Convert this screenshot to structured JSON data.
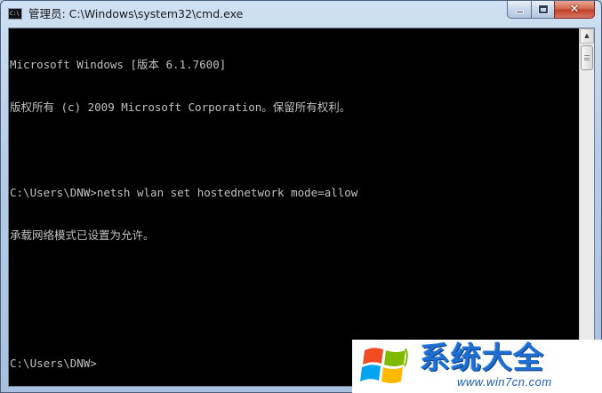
{
  "window": {
    "title": "管理员: C:\\Windows\\system32\\cmd.exe",
    "icon": "cmd-console-icon",
    "icon_text": "C:\\",
    "controls": {
      "minimize": "minimize-icon",
      "maximize": "maximize-icon",
      "close": "close-icon",
      "close_glyph": "✕"
    }
  },
  "console": {
    "lines": [
      "Microsoft Windows [版本 6.1.7600]",
      "版权所有 (c) 2009 Microsoft Corporation。保留所有权利。",
      "",
      "C:\\Users\\DNW>netsh wlan set hostednetwork mode=allow",
      "承载网络模式已设置为允许。",
      "",
      "",
      "C:\\Users\\DNW>"
    ],
    "text_color": "#c0c0c0",
    "background": "#000000"
  },
  "scrollbar": {
    "up_arrow": "▲"
  },
  "watermark": {
    "title": "系统大全",
    "url": "www.win7cn.com",
    "logo": "windows-flag-logo",
    "colors": {
      "red": "#f04b23",
      "green": "#7fba00",
      "blue": "#00a4ef",
      "yellow": "#ffb900"
    }
  }
}
